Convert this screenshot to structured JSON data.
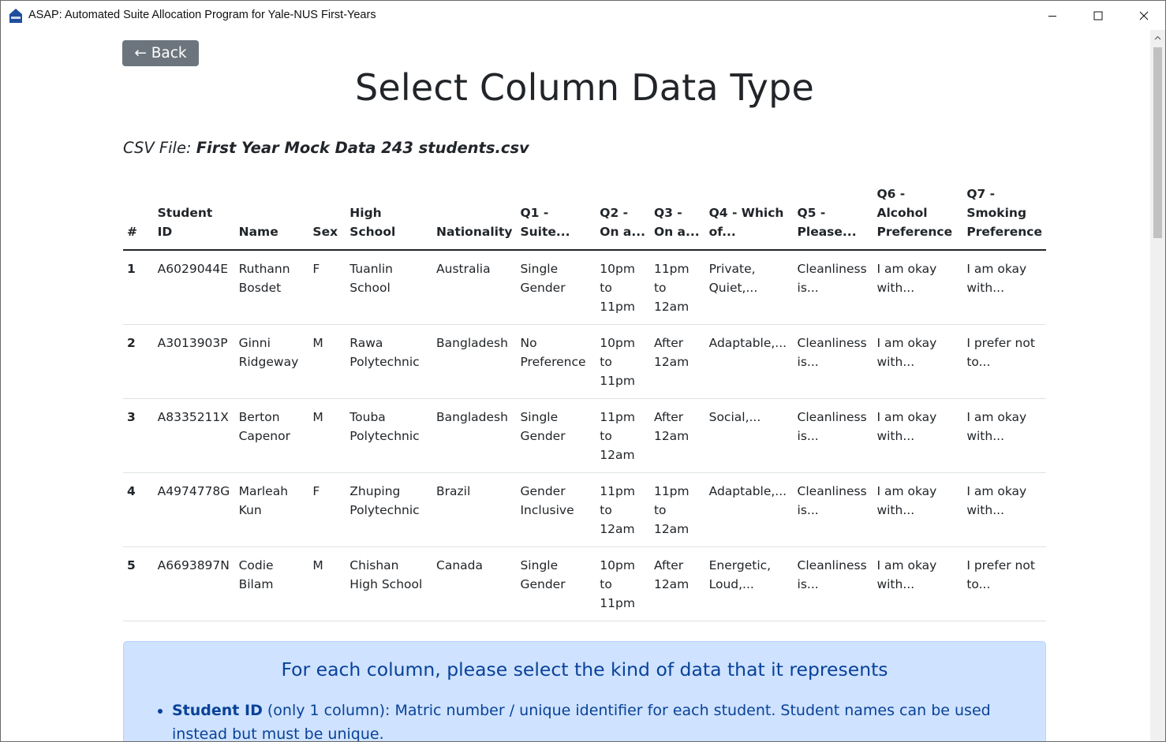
{
  "window": {
    "title": "ASAP: Automated Suite Allocation Program for Yale-NUS First-Years",
    "icon": "house-icon"
  },
  "back_button": {
    "label": "← Back"
  },
  "page_title": "Select Column Data Type",
  "csv": {
    "label": "CSV File:",
    "filename": "First Year Mock Data 243 students.csv"
  },
  "table": {
    "headers": [
      {
        "line1": "#",
        "line2": ""
      },
      {
        "line1": "Student ID",
        "line2": ""
      },
      {
        "line1": "Name",
        "line2": ""
      },
      {
        "line1": "Sex",
        "line2": ""
      },
      {
        "line1": "High",
        "line2": "School"
      },
      {
        "line1": "Nationality",
        "line2": ""
      },
      {
        "line1": "Q1 -",
        "line2": "Suite..."
      },
      {
        "line1": "Q2 -",
        "line2": "On a..."
      },
      {
        "line1": "Q3 -",
        "line2": "On a..."
      },
      {
        "line1": "Q4 - Which",
        "line2": "of..."
      },
      {
        "line1": "Q5 -",
        "line2": "Please..."
      },
      {
        "line1": "Q6 - Alcohol",
        "line2": "Preference"
      },
      {
        "line1": "Q7 -",
        "line2": "Smoking",
        "line3": "Preference"
      }
    ],
    "rows": [
      [
        "1",
        "A6029044E",
        "Ruthann Bosdet",
        "F",
        "Tuanlin School",
        "Australia",
        "Single Gender",
        "10pm to 11pm",
        "11pm to 12am",
        "Private, Quiet,...",
        "Cleanliness is...",
        "I am okay with...",
        "I am okay with..."
      ],
      [
        "2",
        "A3013903P",
        "Ginni Ridgeway",
        "M",
        "Rawa Polytechnic",
        "Bangladesh",
        "No Preference",
        "10pm to 11pm",
        "After 12am",
        "Adaptable,...",
        "Cleanliness is...",
        "I am okay with...",
        "I prefer not to..."
      ],
      [
        "3",
        "A8335211X",
        "Berton Capenor",
        "M",
        "Touba Polytechnic",
        "Bangladesh",
        "Single Gender",
        "11pm to 12am",
        "After 12am",
        "Social,...",
        "Cleanliness is...",
        "I am okay with...",
        "I am okay with..."
      ],
      [
        "4",
        "A4974778G",
        "Marleah Kun",
        "F",
        "Zhuping Polytechnic",
        "Brazil",
        "Gender Inclusive",
        "11pm to 12am",
        "11pm to 12am",
        "Adaptable,...",
        "Cleanliness is...",
        "I am okay with...",
        "I am okay with..."
      ],
      [
        "5",
        "A6693897N",
        "Codie Bilam",
        "M",
        "Chishan High School",
        "Canada",
        "Single Gender",
        "10pm to 11pm",
        "After 12am",
        "Energetic, Loud,...",
        "Cleanliness is...",
        "I am okay with...",
        "I prefer not to..."
      ]
    ]
  },
  "info": {
    "heading": "For each column, please select the kind of data that it represents",
    "items": [
      {
        "term": "Student ID",
        "text": " (only 1 column): Matric number / unique identifier for each student. Student names can be used instead but must be unique."
      }
    ]
  }
}
